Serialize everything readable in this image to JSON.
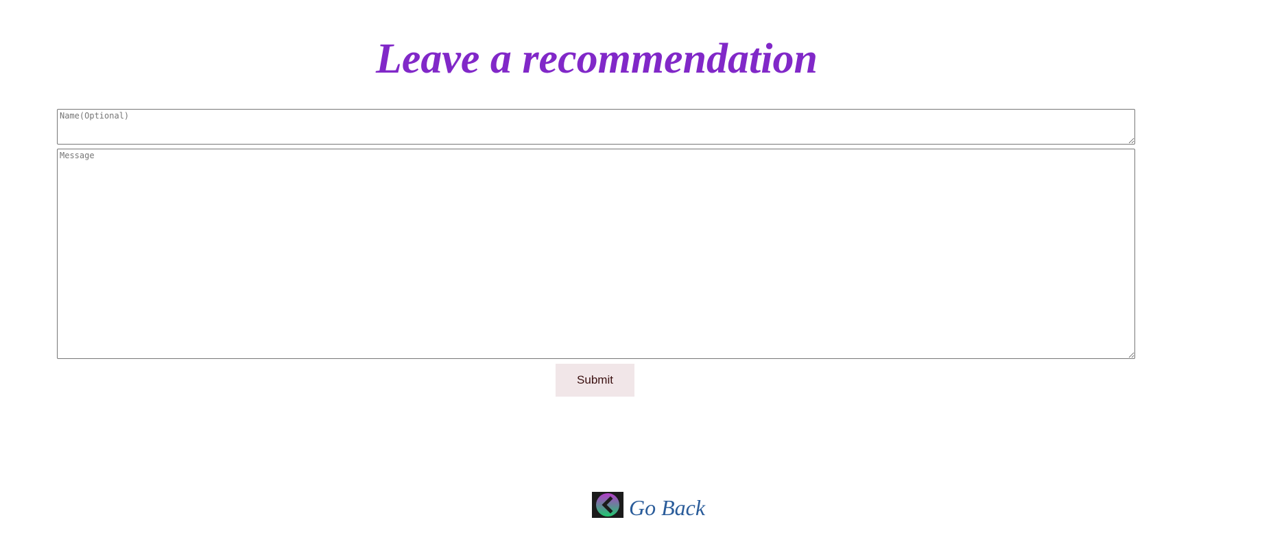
{
  "page": {
    "title": "Leave a recommendation"
  },
  "form": {
    "name_placeholder": "Name(Optional)",
    "name_value": "",
    "message_placeholder": "Message",
    "message_value": "",
    "submit_label": "Submit"
  },
  "footer": {
    "back_label": "Go Back",
    "back_icon": "chevron-left-circle-icon"
  },
  "colors": {
    "title": "#8128c8",
    "link": "#2a5c9a",
    "submit_bg": "#f1e6e8",
    "icon_gradient_top": "#b43cc8",
    "icon_gradient_bottom": "#1fc86e"
  }
}
